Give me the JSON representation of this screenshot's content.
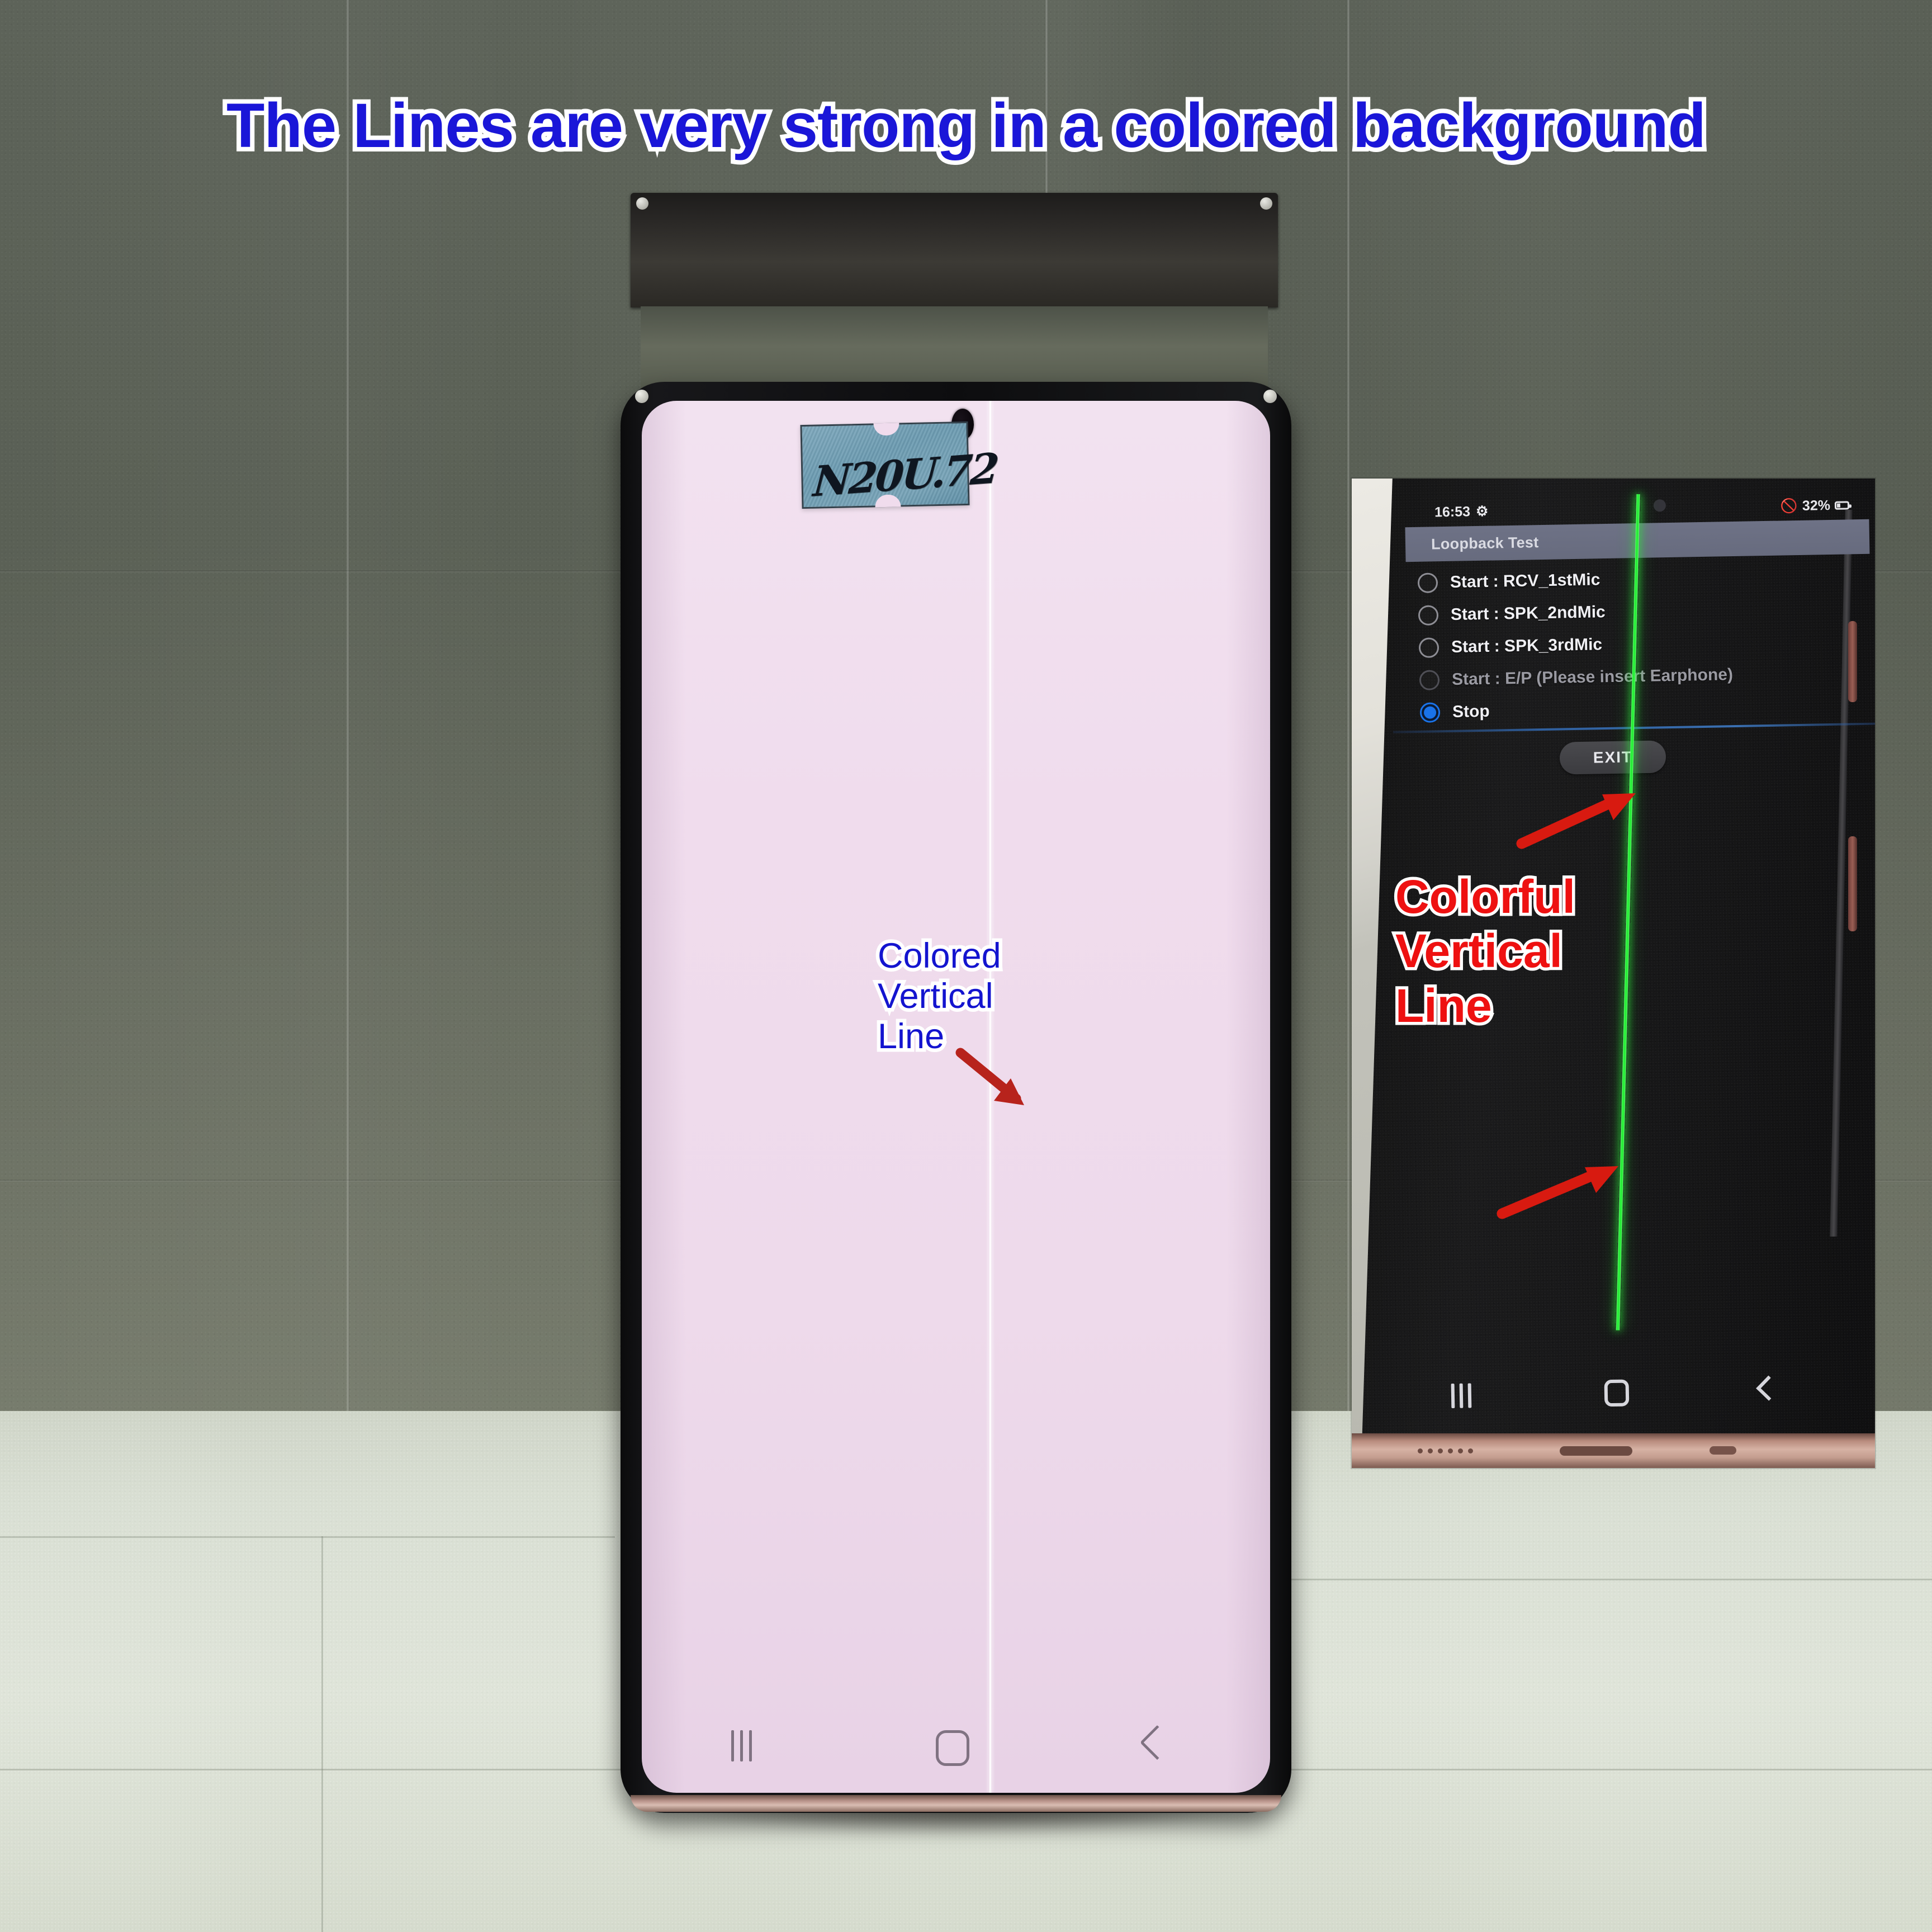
{
  "headline": {
    "text": "The Lines are very strong in a colored background",
    "color": "#1a16d8",
    "outline": "#ffffff"
  },
  "main_phone": {
    "screen_color": "#f0dced",
    "sticker": {
      "handwriting": "N20U.72",
      "color": "#6d9cb2"
    },
    "defect_line": {
      "label": "white vertical line",
      "color": "#ffffff"
    },
    "annotation": {
      "line1": "Colored",
      "line2": "Vertical",
      "line3": "Line",
      "color": "#1414cf",
      "outline": "#ffffff"
    },
    "nav_bar": {
      "recents": "recents-button",
      "home": "home-button",
      "back": "back-button"
    }
  },
  "inset": {
    "status_bar": {
      "time": "16:53",
      "settings_icon": "gear-icon",
      "dnd_icon": "no-symbol-icon",
      "battery": "32%",
      "battery_icon": "battery-icon"
    },
    "app_bar": {
      "title": "Loopback Test"
    },
    "options": [
      {
        "label": "Start : RCV_1stMic",
        "selected": false,
        "disabled": false
      },
      {
        "label": "Start : SPK_2ndMic",
        "selected": false,
        "disabled": false
      },
      {
        "label": "Start : SPK_3rdMic",
        "selected": false,
        "disabled": false
      },
      {
        "label": "Start : E/P (Please insert Earphone)",
        "selected": false,
        "disabled": true
      },
      {
        "label": "Stop",
        "selected": true,
        "disabled": false
      }
    ],
    "exit_button": {
      "label": "EXIT"
    },
    "defect_line": {
      "label": "green vertical line",
      "color": "#18e62a"
    },
    "annotation": {
      "line1": "Colorful",
      "line2": "Vertical",
      "line3": "Line",
      "color": "#ee1111",
      "outline": "#ffffff"
    },
    "nav_bar": {
      "recents": "recents-button",
      "home": "home-button",
      "back": "back-button"
    }
  },
  "scene": {
    "wall_color": "#5a6055",
    "floor_color": "#d9dfd3"
  }
}
